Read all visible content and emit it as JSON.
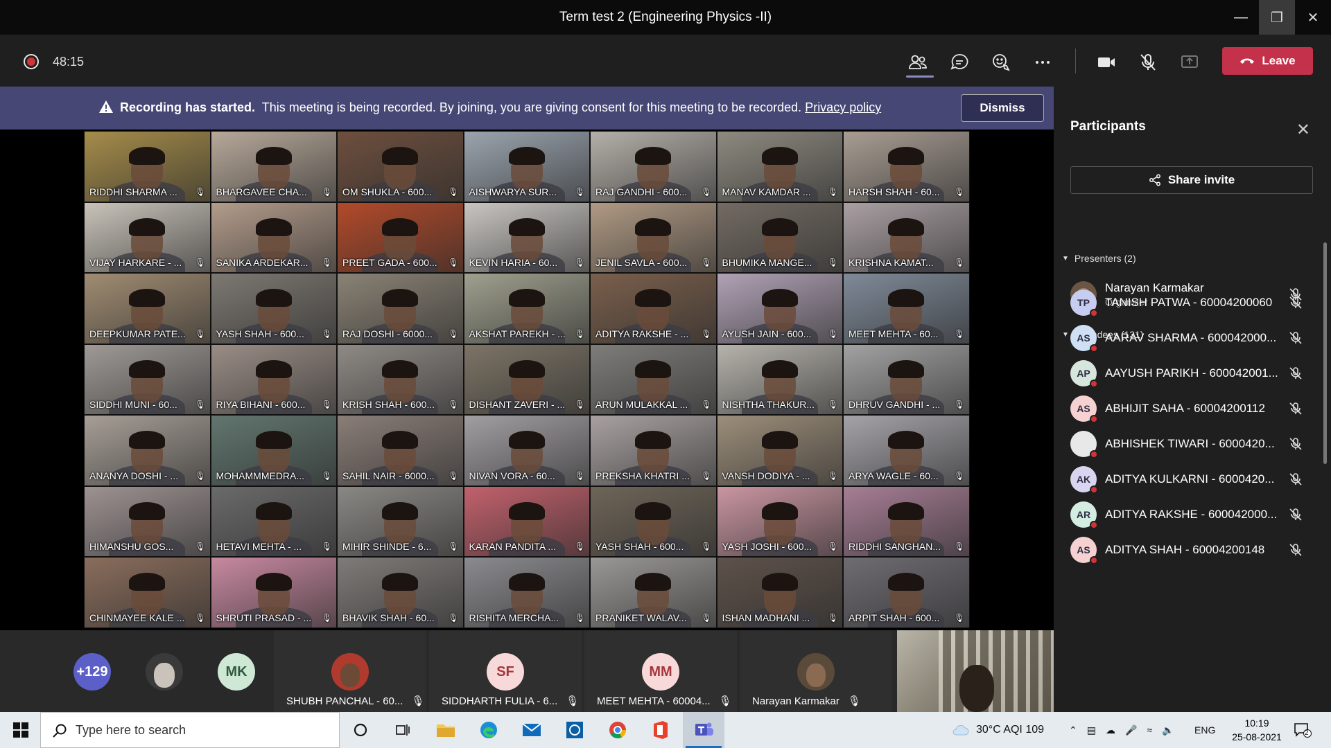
{
  "window": {
    "title": "Term test 2 (Engineering Physics -II)"
  },
  "meeting": {
    "timer": "48:15",
    "leave_label": "Leave"
  },
  "banner": {
    "bold": "Recording has started.",
    "text": "This meeting is being recorded. By joining, you are giving consent for this meeting to be recorded.",
    "link": "Privacy policy",
    "dismiss": "Dismiss"
  },
  "grid": [
    {
      "name": "RIDDHI SHARMA ...",
      "bg": "#a58c4a"
    },
    {
      "name": "BHARGAVEE CHA...",
      "bg": "#b7a99a"
    },
    {
      "name": "OM SHUKLA - 600...",
      "bg": "#6d4f3e"
    },
    {
      "name": "AISHWARYA SUR...",
      "bg": "#9ba4ae"
    },
    {
      "name": "RAJ GANDHI - 600...",
      "bg": "#b4b0a9"
    },
    {
      "name": "MANAV KAMDAR ...",
      "bg": "#8e8a80"
    },
    {
      "name": "HARSH SHAH - 60...",
      "bg": "#a89d93"
    },
    {
      "name": "VIJAY HARKARE - ...",
      "bg": "#c9c3ba"
    },
    {
      "name": "SANIKA ARDEKAR...",
      "bg": "#b39c8b"
    },
    {
      "name": "PREET GADA - 600...",
      "bg": "#b24a2a"
    },
    {
      "name": "KEVIN HARIA - 60...",
      "bg": "#c9c6c2"
    },
    {
      "name": "JENIL SAVLA - 600...",
      "bg": "#b09a84"
    },
    {
      "name": "BHUMIKA MANGE...",
      "bg": "#736b63"
    },
    {
      "name": "KRISHNA KAMAT...",
      "bg": "#aaa0a4"
    },
    {
      "name": "DEEPKUMAR PATE...",
      "bg": "#a08c72"
    },
    {
      "name": "YASH SHAH - 600...",
      "bg": "#7d7872"
    },
    {
      "name": "RAJ DOSHI - 6000...",
      "bg": "#8a8275"
    },
    {
      "name": "AKSHAT PAREKH - ...",
      "bg": "#9fa08e"
    },
    {
      "name": "ADITYA RAKSHE - ...",
      "bg": "#7a5f4c"
    },
    {
      "name": "AYUSH JAIN - 600...",
      "bg": "#b0a2b5"
    },
    {
      "name": "MEET MEHTA - 60...",
      "bg": "#7f8a98"
    },
    {
      "name": "SIDDHI MUNI - 60...",
      "bg": "#9f9a96"
    },
    {
      "name": "RIYA BIHANI - 600...",
      "bg": "#9a8d86"
    },
    {
      "name": "KRISH SHAH - 600...",
      "bg": "#8f8a85"
    },
    {
      "name": "DISHANT ZAVERI - ...",
      "bg": "#7c7466"
    },
    {
      "name": "ARUN MULAKKAL ...",
      "bg": "#7e7d7a"
    },
    {
      "name": "NISHTHA THAKUR...",
      "bg": "#b6b3ac"
    },
    {
      "name": "DHRUV GANDHI - ...",
      "bg": "#a3a2a3"
    },
    {
      "name": "ANANYA DOSHI - ...",
      "bg": "#a79f97"
    },
    {
      "name": "MOHAMMMEDRA...",
      "bg": "#62766f"
    },
    {
      "name": "SAHIL NAIR - 6000...",
      "bg": "#8a7e78"
    },
    {
      "name": "NIVAN VORA - 60...",
      "bg": "#a29fa3"
    },
    {
      "name": "PREKSHA KHATRI ...",
      "bg": "#a9a1a1"
    },
    {
      "name": "VANSH DODIYA - ...",
      "bg": "#9c8e7a"
    },
    {
      "name": "ARYA WAGLE - 60...",
      "bg": "#a5a3a8"
    },
    {
      "name": "HIMANSHU GOS...",
      "bg": "#9e9292"
    },
    {
      "name": "HETAVI MEHTA - ...",
      "bg": "#6b6a6a"
    },
    {
      "name": "MIHIR SHINDE - 6...",
      "bg": "#8a8884"
    },
    {
      "name": "KARAN PANDITA ...",
      "bg": "#c2616c"
    },
    {
      "name": "YASH SHAH - 600...",
      "bg": "#6e6558"
    },
    {
      "name": "YASH JOSHI - 600...",
      "bg": "#c995a1"
    },
    {
      "name": "RIDDHI SANGHAN...",
      "bg": "#a77e95"
    },
    {
      "name": "CHINMAYEE KALE ...",
      "bg": "#8a6d5c"
    },
    {
      "name": "SHRUTI PRASAD - ...",
      "bg": "#c889a0"
    },
    {
      "name": "BHAVIK SHAH - 60...",
      "bg": "#7f7b78"
    },
    {
      "name": "RISHITA MERCHA...",
      "bg": "#8b8b8f"
    },
    {
      "name": "PRANIKET WALAV...",
      "bg": "#9a9896"
    },
    {
      "name": "ISHAN MADHANI ...",
      "bg": "#5e524a"
    },
    {
      "name": "ARPIT SHAH - 600...",
      "bg": "#6f6c72"
    }
  ],
  "bottom": {
    "overflow_count": "+129",
    "mk_initials": "MK",
    "slots": [
      {
        "name": "SHUBH PANCHAL - 60...",
        "initials": "",
        "color": "#b03a2e"
      },
      {
        "name": "SIDDHARTH FULIA - 6...",
        "initials": "SF",
        "color": "#f7d9d9"
      },
      {
        "name": "MEET MEHTA - 60004...",
        "initials": "MM",
        "color": "#f7d9d9"
      },
      {
        "name": "Narayan Karmakar",
        "initials": "",
        "color": "#5a4a3a"
      }
    ]
  },
  "panel": {
    "title": "Participants",
    "share_invite": "Share invite",
    "presenters_label": "Presenters (2)",
    "attendees_label": "Attendees (131)",
    "presenter": {
      "name": "Narayan Karmakar",
      "role": "Organizer"
    },
    "attendees": [
      {
        "initials": "TP",
        "name": "TANISH PATWA - 60004200060",
        "color": "#c7cdf0"
      },
      {
        "initials": "AS",
        "name": "AARAV SHARMA - 600042000...",
        "color": "#cfe0f5"
      },
      {
        "initials": "AP",
        "name": "AAYUSH PARIKH - 600042001...",
        "color": "#d7e6dc"
      },
      {
        "initials": "AS",
        "name": "ABHIJIT SAHA - 60004200112",
        "color": "#f5d1d1"
      },
      {
        "initials": "",
        "name": "ABHISHEK TIWARI - 6000420...",
        "color": "#e8e8e8"
      },
      {
        "initials": "AK",
        "name": "ADITYA KULKARNI - 6000420...",
        "color": "#d9d5f0"
      },
      {
        "initials": "AR",
        "name": "ADITYA RAKSHE - 600042000...",
        "color": "#d3ede3"
      },
      {
        "initials": "AS",
        "name": "ADITYA SHAH - 60004200148",
        "color": "#f5d1d1"
      }
    ]
  },
  "taskbar": {
    "search_placeholder": "Type here to search",
    "weather": "30°C  AQI 109",
    "language": "ENG",
    "time": "10:19",
    "date": "25-08-2021",
    "notif_count": "2"
  }
}
